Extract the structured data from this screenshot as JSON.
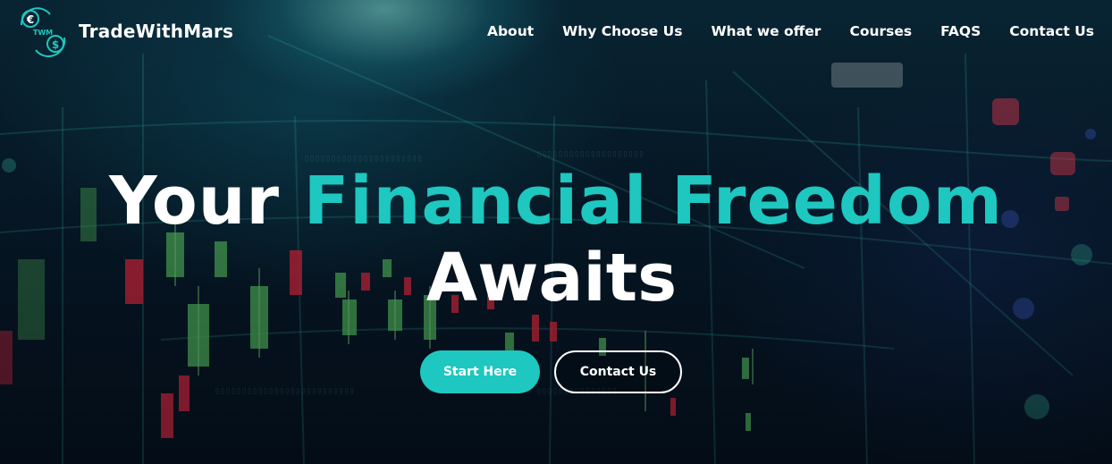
{
  "brand": {
    "name": "TradeWithMars",
    "logo_letters": "TWM",
    "euro_symbol": "€",
    "dollar_symbol": "$"
  },
  "nav": {
    "items": [
      {
        "label": "About"
      },
      {
        "label": "Why Choose Us"
      },
      {
        "label": "What we offer"
      },
      {
        "label": "Courses"
      },
      {
        "label": "FAQS"
      },
      {
        "label": "Contact Us"
      }
    ]
  },
  "hero": {
    "headline_white": "Your",
    "headline_accent": "Financial Freedom",
    "headline_line2": "Awaits",
    "primary_button": "Start Here",
    "secondary_button": "Contact Us"
  },
  "colors": {
    "accent": "#1ec7c0",
    "text": "#ffffff",
    "background": "#06101c",
    "candle_green": "#5fc45a",
    "candle_red": "#d7263d"
  },
  "icons": {
    "logo": "currency-exchange-icon"
  }
}
